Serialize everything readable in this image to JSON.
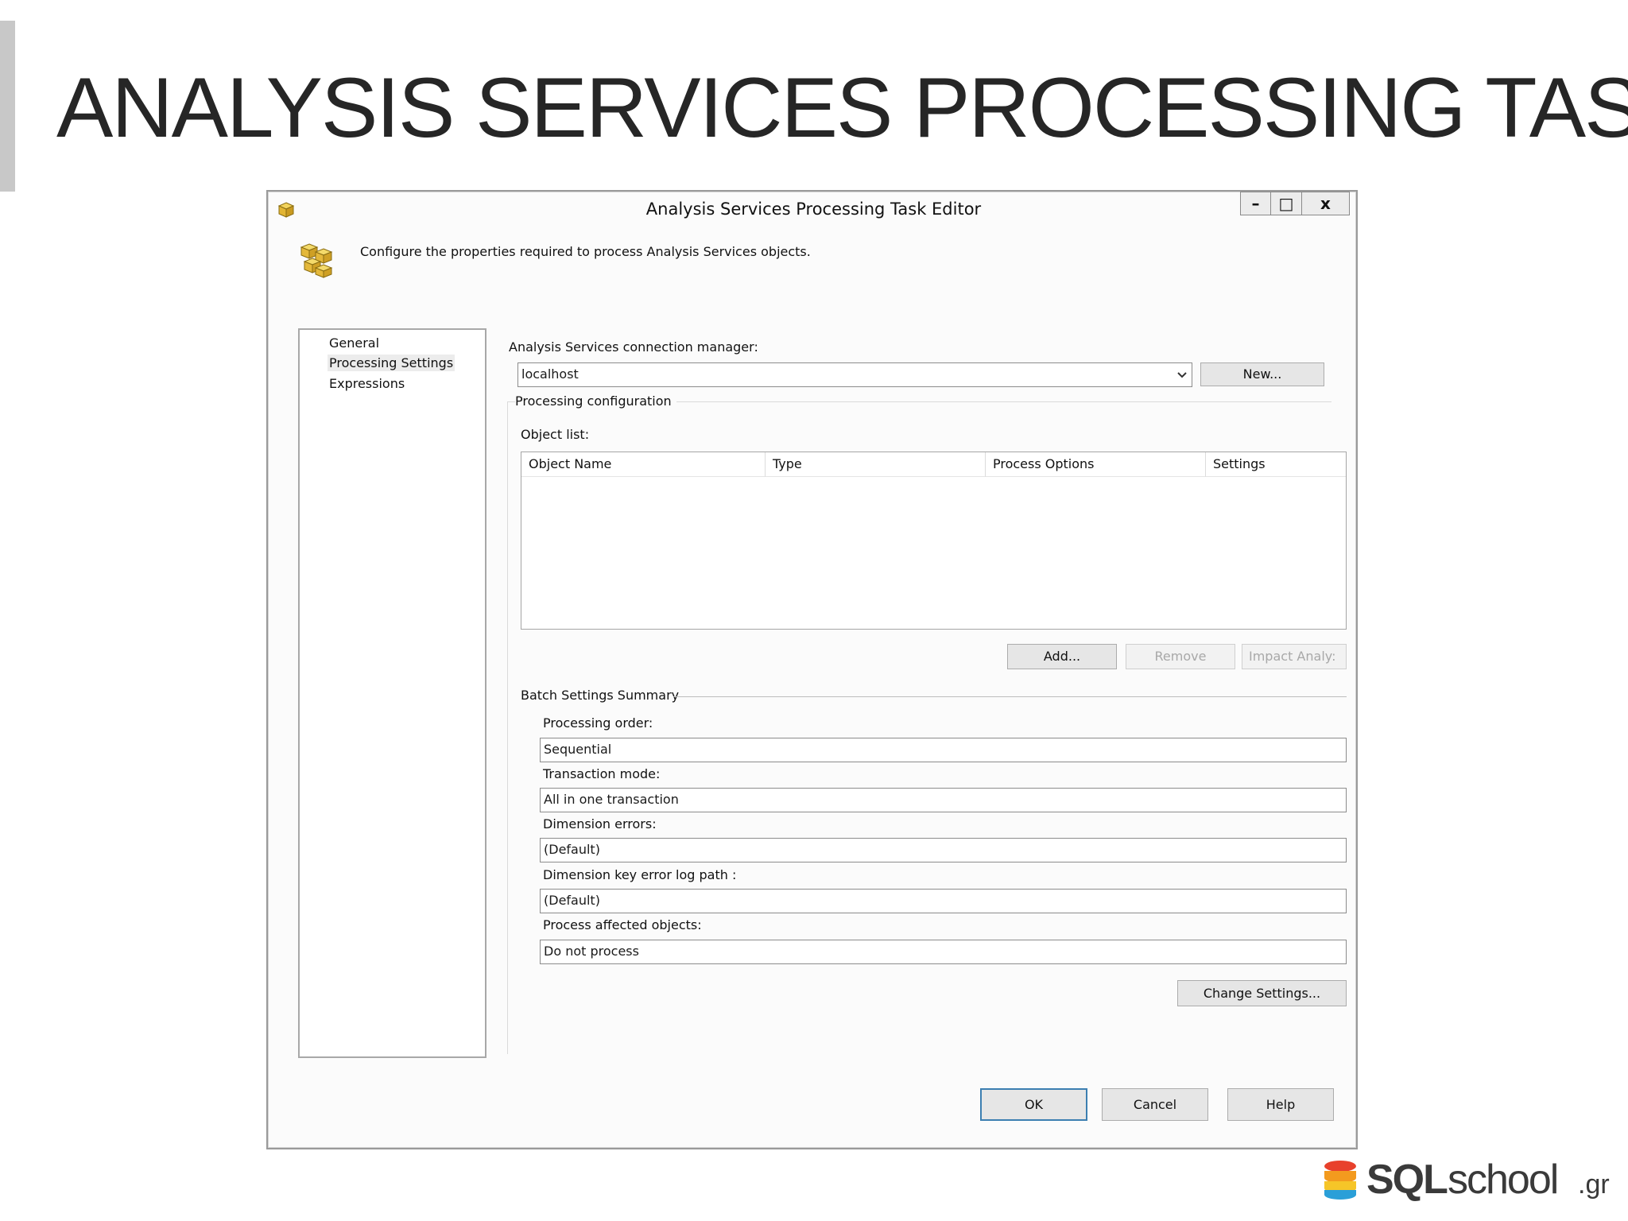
{
  "slide": {
    "title": "ANALYSIS SERVICES PROCESSING TASK"
  },
  "dialog": {
    "title": "Analysis Services Processing Task Editor",
    "window_buttons": {
      "minimize": "–",
      "maximize": "□",
      "close": "x"
    },
    "description": "Configure the properties required to process Analysis Services objects.",
    "nav": {
      "items": [
        {
          "label": "General",
          "selected": false
        },
        {
          "label": "Processing Settings",
          "selected": true
        },
        {
          "label": "Expressions",
          "selected": false
        }
      ]
    },
    "connection": {
      "label": "Analysis Services connection manager:",
      "value": "localhost",
      "new_button": "New..."
    },
    "processing_configuration": {
      "group_label": "Processing configuration",
      "object_list_label": "Object list:",
      "columns": [
        "Object Name",
        "Type",
        "Process Options",
        "Settings"
      ],
      "rows": [],
      "buttons": {
        "add": "Add...",
        "remove": "Remove",
        "impact": "Impact Analy:"
      }
    },
    "batch_settings": {
      "group_label": "Batch Settings Summary",
      "processing_order_label": "Processing order:",
      "processing_order_value": "Sequential",
      "transaction_mode_label": "Transaction mode:",
      "transaction_mode_value": "All in one transaction",
      "dimension_errors_label": "Dimension errors:",
      "dimension_errors_value": "(Default)",
      "dimension_key_log_label": "Dimension key error log path :",
      "dimension_key_log_value": "(Default)",
      "process_affected_label": "Process affected objects:",
      "process_affected_value": "Do not process",
      "change_settings_button": "Change Settings..."
    },
    "footer": {
      "ok": "OK",
      "cancel": "Cancel",
      "help": "Help"
    }
  },
  "branding": {
    "logo_text_bold": "SQL",
    "logo_text": "school",
    "logo_suffix": ".gr"
  }
}
